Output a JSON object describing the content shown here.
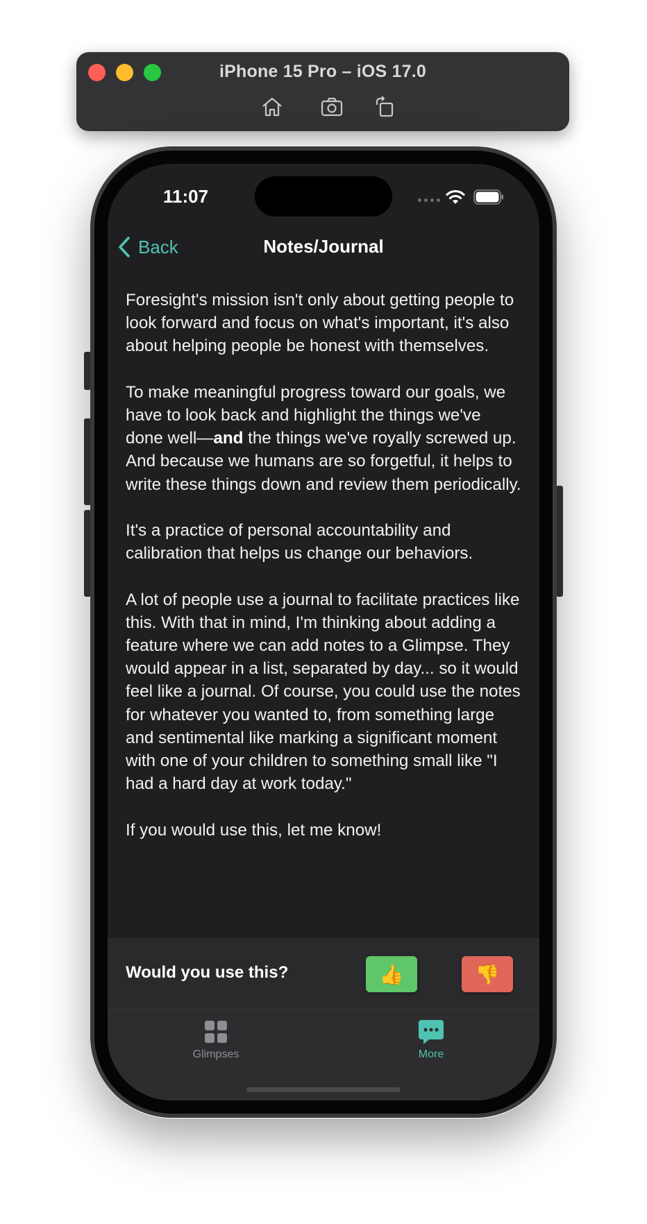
{
  "simulator": {
    "title": "iPhone 15 Pro – iOS 17.0",
    "buttons": [
      "home-icon",
      "screenshot-icon",
      "rotate-icon"
    ]
  },
  "status_bar": {
    "time": "11:07"
  },
  "nav": {
    "back_label": "Back",
    "title": "Notes/Journal"
  },
  "content": {
    "p1": "Foresight's mission isn't only about getting people to look forward and focus on what's important, it's also about helping people be honest with themselves.",
    "p2_before": "To make meaningful progress toward our goals, we have to look back and highlight the things we've done well—",
    "p2_bold": "and",
    "p2_after": " the things we've royally screwed up. And because we humans are so forgetful, it helps to write these things down and review them periodically.",
    "p3": "It's a practice of personal accountability and calibration that helps us change our behaviors.",
    "p4": "A lot of people use a journal to facilitate practices like this. With that in mind, I'm thinking about adding a feature where we can add notes to a Glimpse. They would appear in a list, separated by day... so it would feel like a journal. Of course, you could use the notes for whatever you wanted to, from something large and sentimental like marking a significant moment with one of your children to something small like \"I had a hard day at work today.\"",
    "p5": "If you would use this, let me know!"
  },
  "survey": {
    "question": "Would you use this?",
    "yes_emoji": "👍",
    "no_emoji": "👎"
  },
  "tabs": [
    {
      "label": "Glimpses",
      "icon": "grid-icon",
      "active": false
    },
    {
      "label": "More",
      "icon": "chat-bubble-icon",
      "active": true
    }
  ],
  "colors": {
    "accent": "#4fc3b1",
    "background": "#1f1f21",
    "yes": "#5fc76a",
    "no": "#e0665a"
  }
}
